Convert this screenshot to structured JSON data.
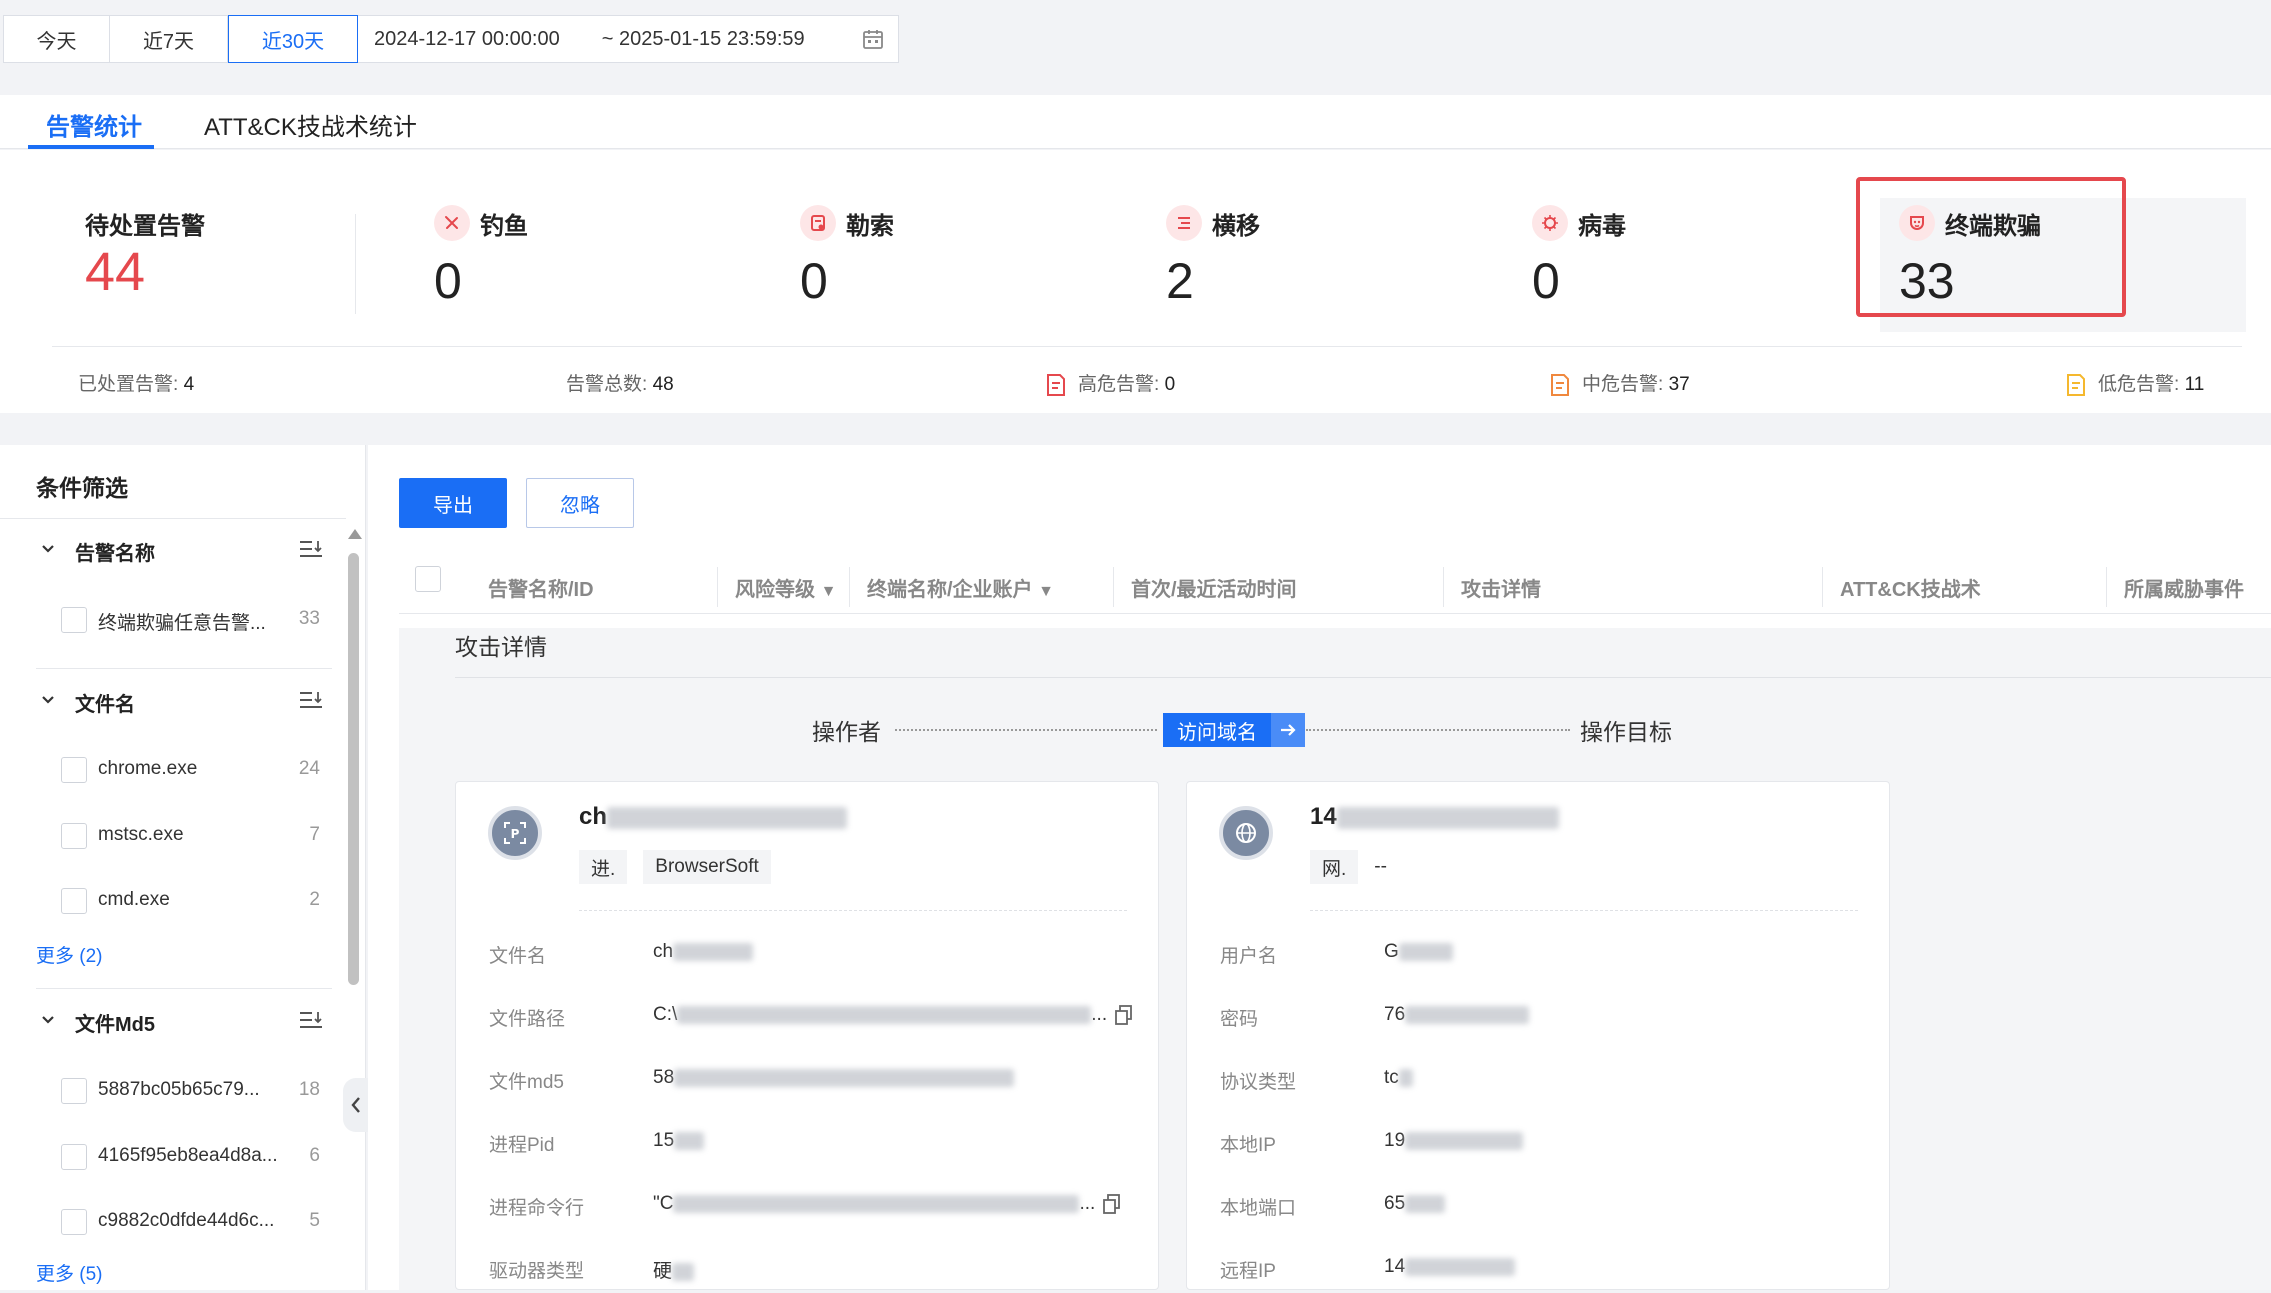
{
  "date_filter": {
    "buttons": [
      "今天",
      "近7天",
      "近30天"
    ],
    "active": "近30天",
    "start": "2024-12-17 00:00:00",
    "end": "~ 2025-01-15 23:59:59"
  },
  "tabs": [
    "告警统计",
    "ATT&CK技战术统计"
  ],
  "stats": {
    "pending_label": "待处置告警",
    "pending_value": "44",
    "categories": [
      {
        "name": "钓鱼",
        "value": "0",
        "icon": "phishing-icon"
      },
      {
        "name": "勒索",
        "value": "0",
        "icon": "ransomware-icon"
      },
      {
        "name": "横移",
        "value": "2",
        "icon": "lateral-move-icon"
      },
      {
        "name": "病毒",
        "value": "0",
        "icon": "virus-icon"
      },
      {
        "name": "终端欺骗",
        "value": "33",
        "icon": "deception-icon"
      }
    ],
    "summary": [
      {
        "label": "已处置告警:",
        "value": "4"
      },
      {
        "label": "告警总数:",
        "value": "48"
      },
      {
        "label": "高危告警:",
        "value": "0"
      },
      {
        "label": "中危告警:",
        "value": "37"
      },
      {
        "label": "低危告警:",
        "value": "11"
      }
    ],
    "colors": {
      "high": "#e5484d",
      "medium": "#f0883e",
      "low": "#f5b82e",
      "highlight": "#e5484d"
    }
  },
  "filter": {
    "title": "条件筛选",
    "groups": [
      {
        "title": "告警名称",
        "items": [
          {
            "name": "终端欺骗任意告警...",
            "count": "33"
          }
        ],
        "more": ""
      },
      {
        "title": "文件名",
        "items": [
          {
            "name": "chrome.exe",
            "count": "24"
          },
          {
            "name": "mstsc.exe",
            "count": "7"
          },
          {
            "name": "cmd.exe",
            "count": "2"
          }
        ],
        "more": "更多 (2)"
      },
      {
        "title": "文件Md5",
        "items": [
          {
            "name": "5887bc05b65c79...",
            "count": "18"
          },
          {
            "name": "4165f95eb8ea4d8a...",
            "count": "6"
          },
          {
            "name": "c9882c0dfde44d6c...",
            "count": "5"
          }
        ],
        "more": "更多 (5)"
      }
    ]
  },
  "toolbar": {
    "export": "导出",
    "ignore": "忽略"
  },
  "table": {
    "columns": [
      "告警名称/ID",
      "风险等级",
      "终端名称/企业账户",
      "首次/最近活动时间",
      "攻击详情",
      "ATT&CK技战术",
      "所属威胁事件"
    ]
  },
  "detail": {
    "title": "攻击详情",
    "flow": {
      "actor": "操作者",
      "action": "访问域名",
      "target": "操作目标"
    },
    "actor_card": {
      "name_prefix": "ch",
      "tag_label": "进.",
      "tag_value": "BrowserSoft",
      "fields": [
        {
          "label": "文件名",
          "prefix": "ch"
        },
        {
          "label": "文件路径",
          "prefix": "C:\\"
        },
        {
          "label": "文件md5",
          "prefix": "58"
        },
        {
          "label": "进程Pid",
          "prefix": "15"
        },
        {
          "label": "进程命令行",
          "prefix": "\"C"
        },
        {
          "label": "驱动器类型",
          "prefix": "硬"
        }
      ]
    },
    "target_card": {
      "name_prefix": "14",
      "tag_label": "网.",
      "tag_value": "--",
      "fields": [
        {
          "label": "用户名",
          "prefix": "G"
        },
        {
          "label": "密码",
          "prefix": "76"
        },
        {
          "label": "协议类型",
          "prefix": "tc"
        },
        {
          "label": "本地IP",
          "prefix": "19"
        },
        {
          "label": "本地端口",
          "prefix": "65"
        },
        {
          "label": "远程IP",
          "prefix": "14"
        }
      ]
    }
  }
}
